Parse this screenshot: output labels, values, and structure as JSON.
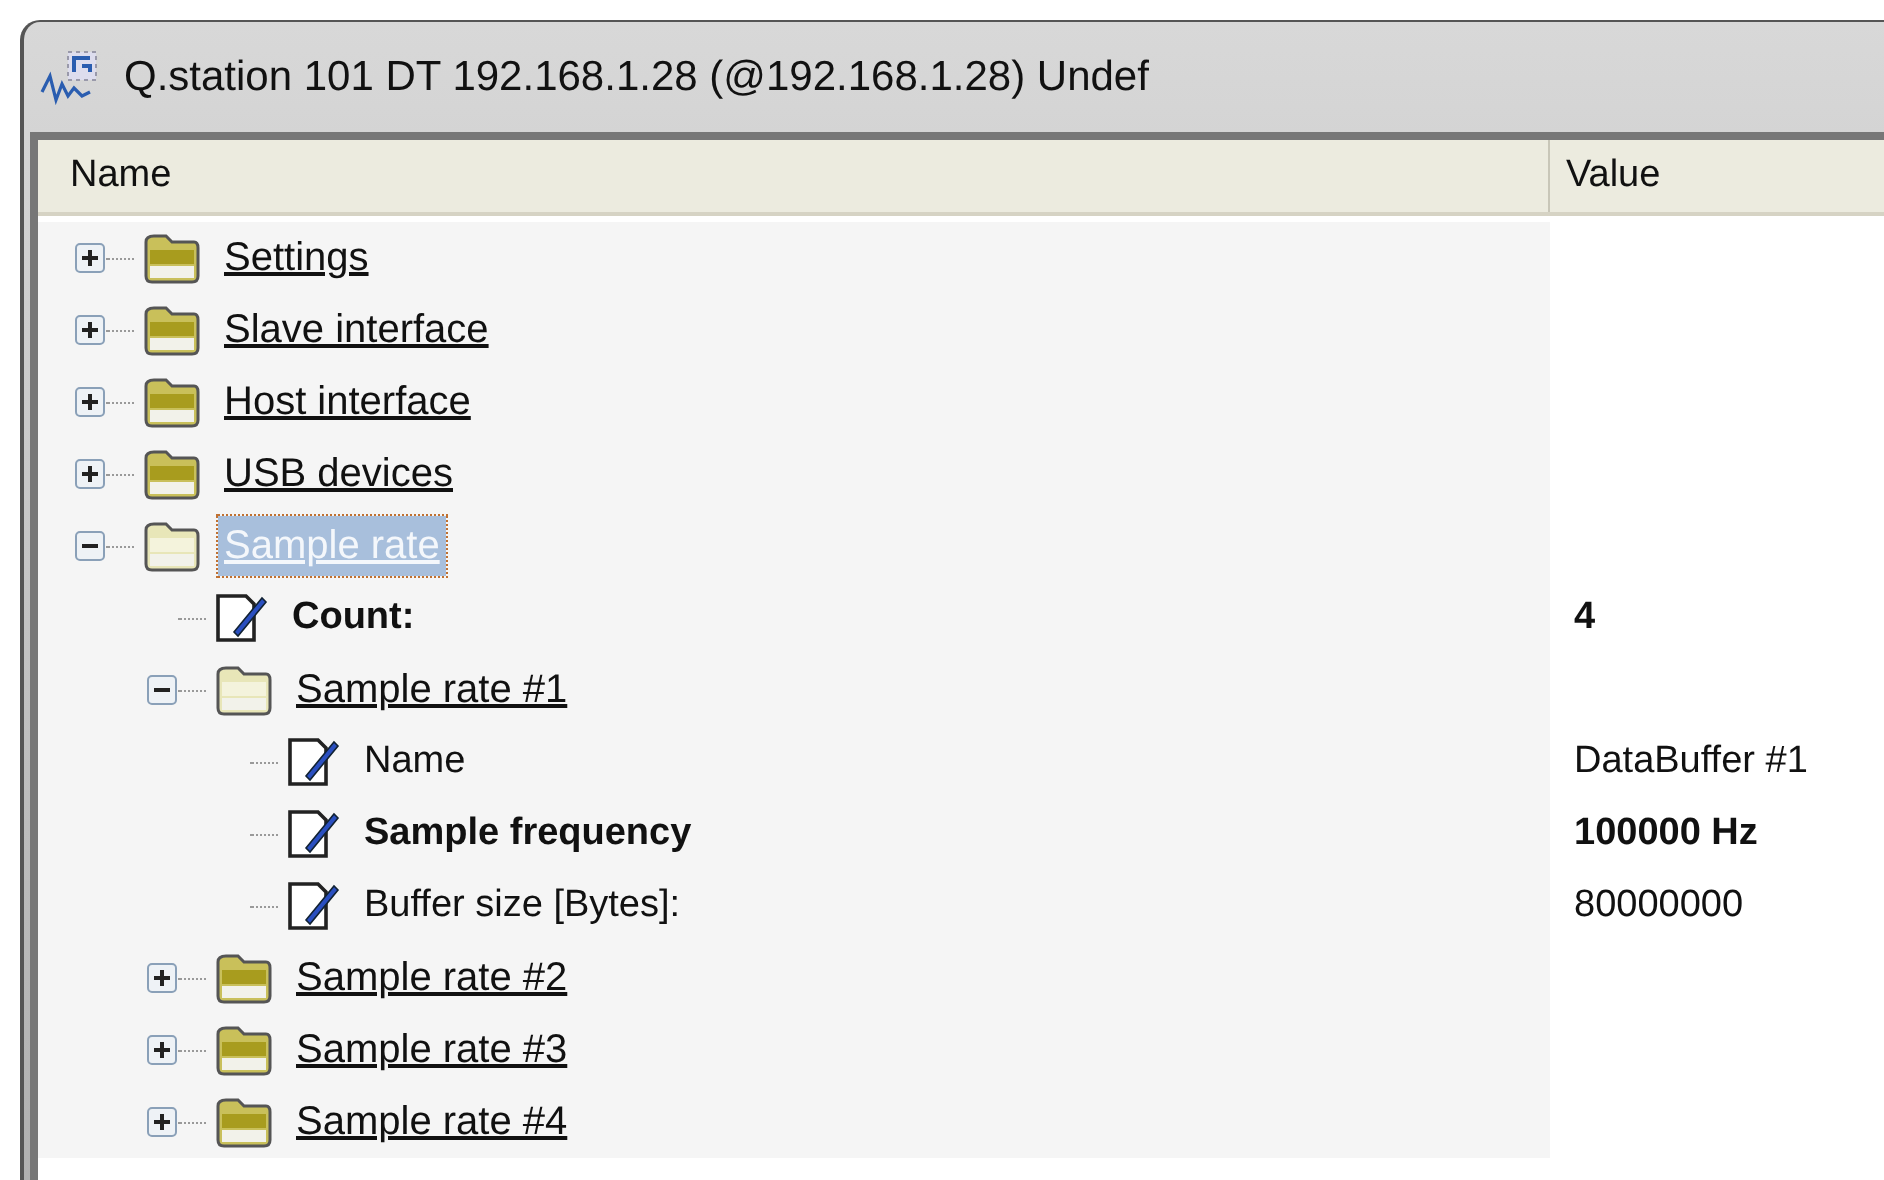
{
  "window": {
    "title": "Q.station 101 DT 192.168.1.28 (@192.168.1.28) Undef"
  },
  "columns": [
    "Name",
    "Value"
  ],
  "tree": [
    {
      "kind": "folder",
      "label": "Settings",
      "expanded": false,
      "selected": false
    },
    {
      "kind": "folder",
      "label": "Slave interface",
      "expanded": false,
      "selected": false
    },
    {
      "kind": "folder",
      "label": "Host interface",
      "expanded": false,
      "selected": false
    },
    {
      "kind": "folder",
      "label": "USB devices",
      "expanded": false,
      "selected": false
    },
    {
      "kind": "folder",
      "label": "Sample rate",
      "expanded": true,
      "selected": true,
      "children": [
        {
          "kind": "property",
          "label": "Count:",
          "value": "4",
          "bold": true
        },
        {
          "kind": "folder",
          "label": "Sample rate #1",
          "expanded": true,
          "selected": false,
          "children": [
            {
              "kind": "property",
              "label": "Name",
              "value": "DataBuffer #1",
              "bold": false
            },
            {
              "kind": "property",
              "label": "Sample frequency",
              "value": "100000 Hz",
              "bold": true
            },
            {
              "kind": "property",
              "label": "Buffer size [Bytes]:",
              "value": "80000000",
              "bold": false
            }
          ]
        },
        {
          "kind": "folder",
          "label": "Sample rate #2",
          "expanded": false,
          "selected": false
        },
        {
          "kind": "folder",
          "label": "Sample rate #3",
          "expanded": false,
          "selected": false
        },
        {
          "kind": "folder",
          "label": "Sample rate #4",
          "expanded": false,
          "selected": false
        }
      ]
    }
  ]
}
